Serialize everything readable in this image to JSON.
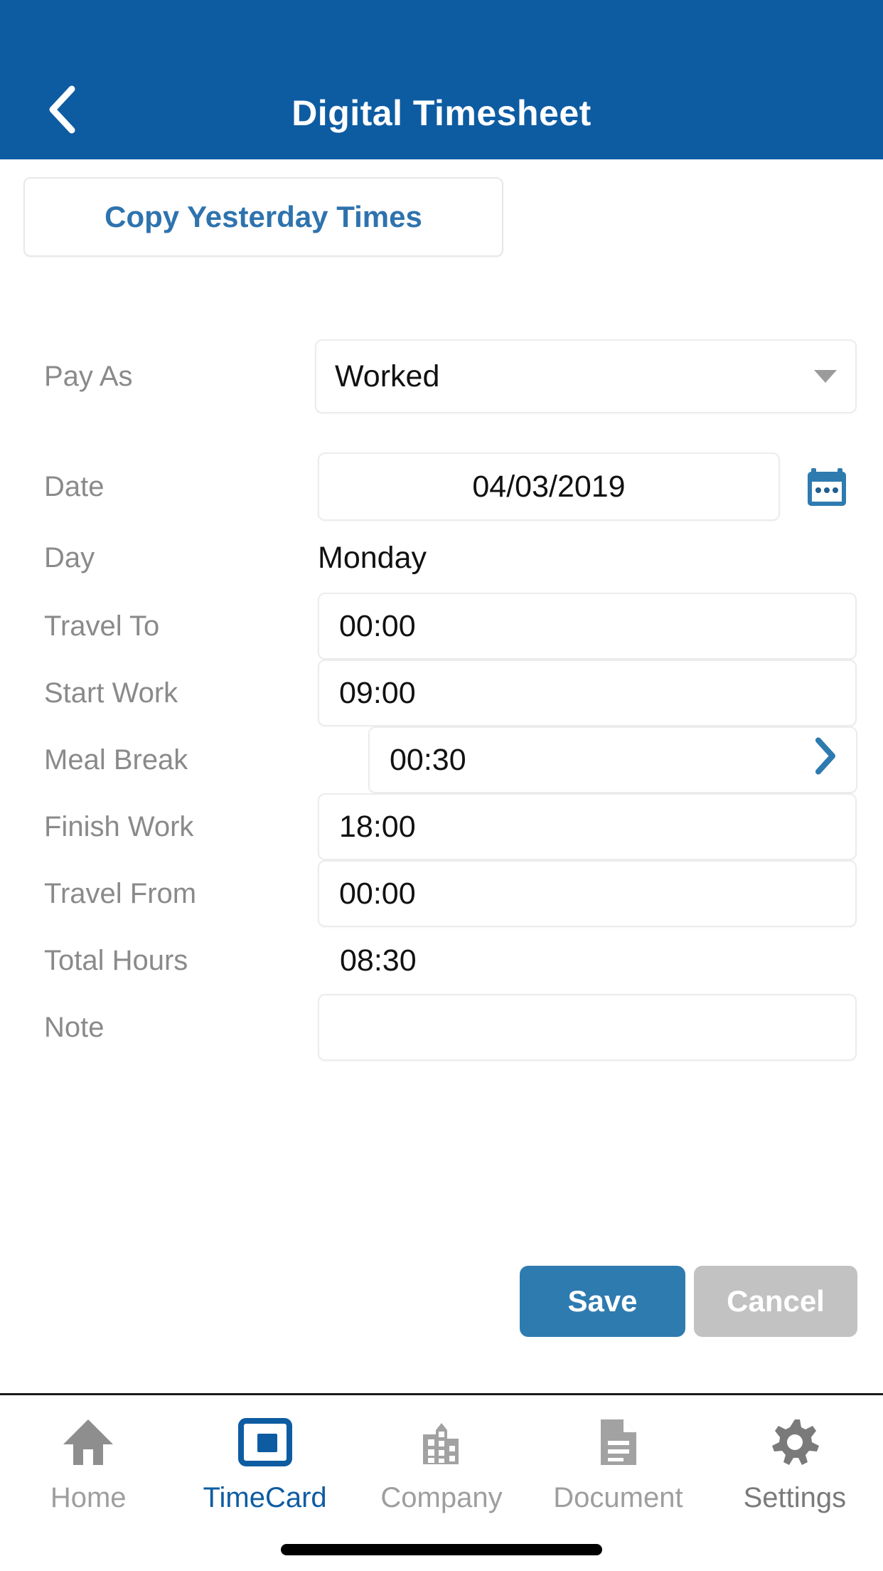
{
  "header": {
    "title": "Digital Timesheet",
    "back_icon": "chevron-left-icon"
  },
  "copy_button": {
    "label": "Copy Yesterday Times"
  },
  "form": {
    "pay_as": {
      "label": "Pay As",
      "value": "Worked",
      "caret_icon": "chevron-down-icon"
    },
    "date": {
      "label": "Date",
      "value": "04/03/2019",
      "icon": "calendar-icon"
    },
    "day": {
      "label": "Day",
      "value": "Monday"
    },
    "travel_to": {
      "label": "Travel To",
      "value": "00:00"
    },
    "start_work": {
      "label": "Start Work",
      "value": "09:00"
    },
    "meal_break": {
      "label": "Meal Break",
      "value": "00:30",
      "chevron_icon": "chevron-right-icon"
    },
    "finish_work": {
      "label": "Finish Work",
      "value": "18:00"
    },
    "travel_from": {
      "label": "Travel From",
      "value": "00:00"
    },
    "total_hours": {
      "label": "Total Hours",
      "value": "08:30"
    },
    "note": {
      "label": "Note",
      "value": "",
      "placeholder": ""
    }
  },
  "actions": {
    "save_label": "Save",
    "cancel_label": "Cancel"
  },
  "bottom_nav": {
    "items": [
      {
        "label": "Home",
        "icon": "home-icon"
      },
      {
        "label": "TimeCard",
        "icon": "timecard-icon"
      },
      {
        "label": "Company",
        "icon": "building-icon"
      },
      {
        "label": "Document",
        "icon": "document-icon"
      },
      {
        "label": "Settings",
        "icon": "gear-icon"
      }
    ]
  },
  "colors": {
    "header_blue": "#0d5ca2",
    "accent_blue": "#2e7bb0",
    "link_blue": "#2e73ae",
    "cancel_gray": "#c2c2c2",
    "label_gray": "#8a8a8a"
  }
}
